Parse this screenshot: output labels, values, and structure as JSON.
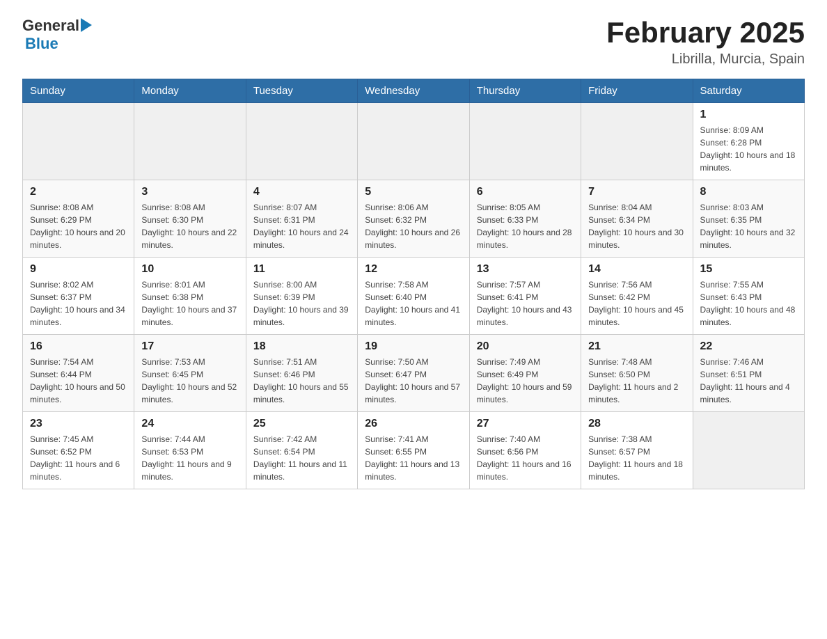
{
  "header": {
    "logo": {
      "text_general": "General",
      "text_blue": "Blue",
      "aria": "GeneralBlue logo"
    },
    "title": "February 2025",
    "subtitle": "Librilla, Murcia, Spain"
  },
  "days_of_week": [
    "Sunday",
    "Monday",
    "Tuesday",
    "Wednesday",
    "Thursday",
    "Friday",
    "Saturday"
  ],
  "weeks": [
    {
      "days": [
        {
          "number": "",
          "info": ""
        },
        {
          "number": "",
          "info": ""
        },
        {
          "number": "",
          "info": ""
        },
        {
          "number": "",
          "info": ""
        },
        {
          "number": "",
          "info": ""
        },
        {
          "number": "",
          "info": ""
        },
        {
          "number": "1",
          "info": "Sunrise: 8:09 AM\nSunset: 6:28 PM\nDaylight: 10 hours and 18 minutes."
        }
      ]
    },
    {
      "days": [
        {
          "number": "2",
          "info": "Sunrise: 8:08 AM\nSunset: 6:29 PM\nDaylight: 10 hours and 20 minutes."
        },
        {
          "number": "3",
          "info": "Sunrise: 8:08 AM\nSunset: 6:30 PM\nDaylight: 10 hours and 22 minutes."
        },
        {
          "number": "4",
          "info": "Sunrise: 8:07 AM\nSunset: 6:31 PM\nDaylight: 10 hours and 24 minutes."
        },
        {
          "number": "5",
          "info": "Sunrise: 8:06 AM\nSunset: 6:32 PM\nDaylight: 10 hours and 26 minutes."
        },
        {
          "number": "6",
          "info": "Sunrise: 8:05 AM\nSunset: 6:33 PM\nDaylight: 10 hours and 28 minutes."
        },
        {
          "number": "7",
          "info": "Sunrise: 8:04 AM\nSunset: 6:34 PM\nDaylight: 10 hours and 30 minutes."
        },
        {
          "number": "8",
          "info": "Sunrise: 8:03 AM\nSunset: 6:35 PM\nDaylight: 10 hours and 32 minutes."
        }
      ]
    },
    {
      "days": [
        {
          "number": "9",
          "info": "Sunrise: 8:02 AM\nSunset: 6:37 PM\nDaylight: 10 hours and 34 minutes."
        },
        {
          "number": "10",
          "info": "Sunrise: 8:01 AM\nSunset: 6:38 PM\nDaylight: 10 hours and 37 minutes."
        },
        {
          "number": "11",
          "info": "Sunrise: 8:00 AM\nSunset: 6:39 PM\nDaylight: 10 hours and 39 minutes."
        },
        {
          "number": "12",
          "info": "Sunrise: 7:58 AM\nSunset: 6:40 PM\nDaylight: 10 hours and 41 minutes."
        },
        {
          "number": "13",
          "info": "Sunrise: 7:57 AM\nSunset: 6:41 PM\nDaylight: 10 hours and 43 minutes."
        },
        {
          "number": "14",
          "info": "Sunrise: 7:56 AM\nSunset: 6:42 PM\nDaylight: 10 hours and 45 minutes."
        },
        {
          "number": "15",
          "info": "Sunrise: 7:55 AM\nSunset: 6:43 PM\nDaylight: 10 hours and 48 minutes."
        }
      ]
    },
    {
      "days": [
        {
          "number": "16",
          "info": "Sunrise: 7:54 AM\nSunset: 6:44 PM\nDaylight: 10 hours and 50 minutes."
        },
        {
          "number": "17",
          "info": "Sunrise: 7:53 AM\nSunset: 6:45 PM\nDaylight: 10 hours and 52 minutes."
        },
        {
          "number": "18",
          "info": "Sunrise: 7:51 AM\nSunset: 6:46 PM\nDaylight: 10 hours and 55 minutes."
        },
        {
          "number": "19",
          "info": "Sunrise: 7:50 AM\nSunset: 6:47 PM\nDaylight: 10 hours and 57 minutes."
        },
        {
          "number": "20",
          "info": "Sunrise: 7:49 AM\nSunset: 6:49 PM\nDaylight: 10 hours and 59 minutes."
        },
        {
          "number": "21",
          "info": "Sunrise: 7:48 AM\nSunset: 6:50 PM\nDaylight: 11 hours and 2 minutes."
        },
        {
          "number": "22",
          "info": "Sunrise: 7:46 AM\nSunset: 6:51 PM\nDaylight: 11 hours and 4 minutes."
        }
      ]
    },
    {
      "days": [
        {
          "number": "23",
          "info": "Sunrise: 7:45 AM\nSunset: 6:52 PM\nDaylight: 11 hours and 6 minutes."
        },
        {
          "number": "24",
          "info": "Sunrise: 7:44 AM\nSunset: 6:53 PM\nDaylight: 11 hours and 9 minutes."
        },
        {
          "number": "25",
          "info": "Sunrise: 7:42 AM\nSunset: 6:54 PM\nDaylight: 11 hours and 11 minutes."
        },
        {
          "number": "26",
          "info": "Sunrise: 7:41 AM\nSunset: 6:55 PM\nDaylight: 11 hours and 13 minutes."
        },
        {
          "number": "27",
          "info": "Sunrise: 7:40 AM\nSunset: 6:56 PM\nDaylight: 11 hours and 16 minutes."
        },
        {
          "number": "28",
          "info": "Sunrise: 7:38 AM\nSunset: 6:57 PM\nDaylight: 11 hours and 18 minutes."
        },
        {
          "number": "",
          "info": ""
        }
      ]
    }
  ]
}
